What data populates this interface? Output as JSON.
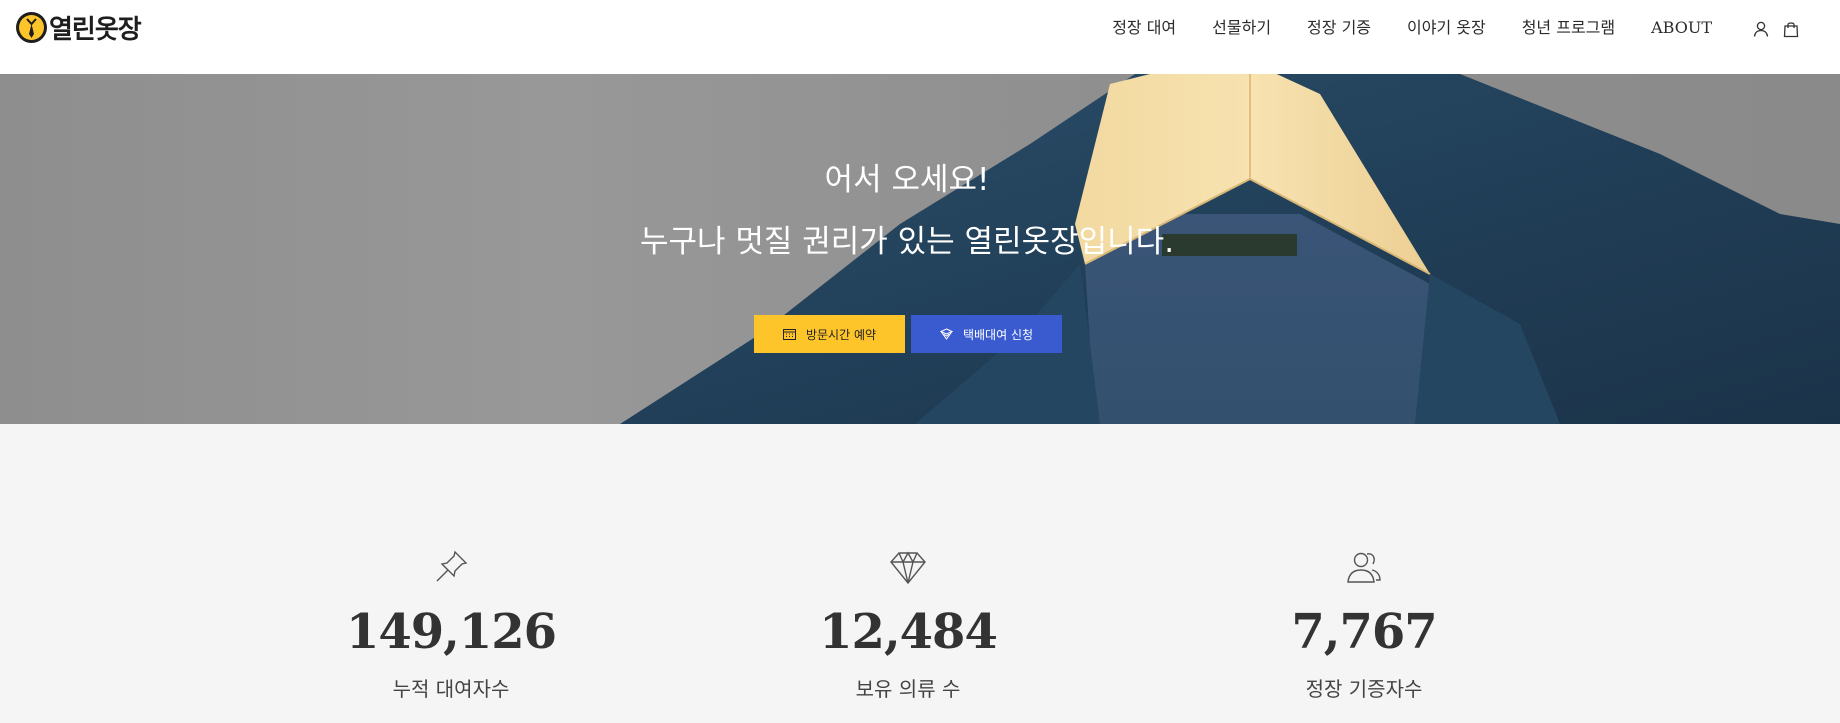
{
  "header": {
    "logo_text": "열린옷장",
    "nav": [
      "정장 대여",
      "선물하기",
      "정장 기증",
      "이야기 옷장",
      "청년 프로그램",
      "ABOUT"
    ],
    "icons": [
      "user-icon",
      "shopping-bag-icon"
    ]
  },
  "hero": {
    "title": "어서 오세요!",
    "subtitle": "누구나 멋질 권리가 있는 열린옷장입니다.",
    "buttons": {
      "reserve_label": "방문시간 예약",
      "delivery_label": "택배대여 신청"
    }
  },
  "stats": [
    {
      "icon": "pin-icon",
      "value": "149,126",
      "label": "누적 대여자수"
    },
    {
      "icon": "diamond-icon",
      "value": "12,484",
      "label": "보유 의류 수"
    },
    {
      "icon": "users-icon",
      "value": "7,767",
      "label": "정장 기증자수"
    }
  ],
  "colors": {
    "reserve_button": "#fdc52a",
    "delivery_button": "#3a5bd0",
    "hero_bg": "#919191",
    "stats_bg": "#f5f5f5"
  }
}
